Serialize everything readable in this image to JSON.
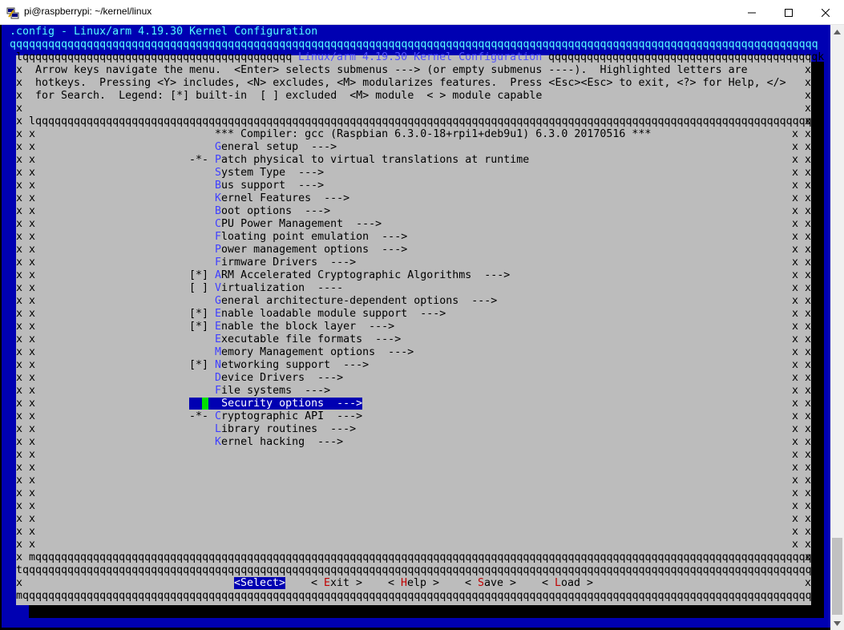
{
  "window": {
    "title": "pi@raspberrypi: ~/kernel/linux",
    "icon": "putty-icon",
    "controls": [
      "minimize",
      "maximize",
      "close"
    ]
  },
  "colors": {
    "terminal_bg": "#0000b2",
    "dialog_bg": "#bcbcbc",
    "hotkey": "#4040ff",
    "selected_bg": "#0000b2",
    "cursor": "#00e000",
    "button_hotkey": "#c00000"
  },
  "terminal": {
    "header": ".config - Linux/arm 4.19.30 Kernel Configuration",
    "fill_line": "qqqqqqqqqqqqqqqqqqqqqqqqqqqqqqqqqqqqqqqqqqqqqqqqqqqqqqqqqqqqqqqqqqqqqqqqqqqqqqqqqqqqqqqqqqqqqqqqqqqqqqqqqqqqqqqqqqqqqqqqqqqqqq"
  },
  "dialog": {
    "title": " Linux/arm 4.19.30 Kernel Configuration ",
    "top_left_fill": "lqqqqqqqqqqqqqqqqqqqqqqqqqqqqqqqqqqqqqqqqqq",
    "top_right_fill": "qqqqqqqqqqqqqqqqqqqqqqqqqqqqqqqqqqqqqqqqqqk",
    "help_lines": [
      "Arrow keys navigate the menu.  <Enter> selects submenus ---> (or empty submenus ----).  Highlighted letters are",
      "hotkeys.  Pressing <Y> includes, <N> excludes, <M> modularizes features.  Press <Esc><Esc> to exit, <?> for Help, </>",
      "for Search.  Legend: [*] built-in  [ ] excluded  <M> module  < > module capable"
    ],
    "menu_top_border": "lqqqqqqqqqqqqqqqqqqqqqqqqqqqqqqqqqqqqqqqqqqqqqqqqqqqqqqqqqqqqqqqqqqqqqqqqqqqqqqqqqqqqqqqqqqqqqqqqqqqqqqqqqqqqqqqqqqqqqqqqqk",
    "menu_bottom_border": "mqqqqqqqqqqqqqqqqqqqqqqqqqqqqqqqqqqqqqqqqqqqqqqqqqqqqqqqqqqqqqqqqqqqqqqqqqqqqqqqqqqqqqqqqqqqqqqqqqqqqqqqqqqqqqqqqqqqqqqqqqj",
    "button_separator": "tqqqqqqqqqqqqqqqqqqqqqqqqqqqqqqqqqqqqqqqqqqqqqqqqqqqqqqqqqqqqqqqqqqqqqqqqqqqqqqqqqqqqqqqqqqqqqqqqqqqqqqqqqqqqqqqqqqqqqqqqqqqu",
    "bottom_border": "mqqqqqqqqqqqqqqqqqqqqqqqqqqqqqqqqqqqqqqqqqqqqqqqqqqqqqqqqqqqqqqqqqqqqqqqqqqqqqqqqqqqqqqqqqqqqqqqqqqqqqqqqqqqqqqqqqqqqqqqqqqqqj",
    "side_char": "x",
    "menu_items": [
      {
        "prefix": "   ",
        "hot": "",
        "rest": "*** Compiler: gcc (Raspbian 6.3.0-18+rpi1+deb9u1) 6.3.0 20170516 ***"
      },
      {
        "prefix": "   ",
        "hot": "G",
        "rest": "eneral setup  --->"
      },
      {
        "prefix": "-*-",
        "hot": "P",
        "rest": "atch physical to virtual translations at runtime"
      },
      {
        "prefix": "   ",
        "hot": "S",
        "rest": "ystem Type  --->"
      },
      {
        "prefix": "   ",
        "hot": "B",
        "rest": "us support  --->"
      },
      {
        "prefix": "   ",
        "hot": "K",
        "rest": "ernel Features  --->"
      },
      {
        "prefix": "   ",
        "hot": "B",
        "rest": "oot options  --->"
      },
      {
        "prefix": "   ",
        "hot": "C",
        "rest": "PU Power Management  --->"
      },
      {
        "prefix": "   ",
        "hot": "F",
        "rest": "loating point emulation  --->"
      },
      {
        "prefix": "   ",
        "hot": "P",
        "rest": "ower management options  --->"
      },
      {
        "prefix": "   ",
        "hot": "F",
        "rest": "irmware Drivers  --->"
      },
      {
        "prefix": "[*]",
        "hot": "A",
        "rest": "RM Accelerated Cryptographic Algorithms  --->"
      },
      {
        "prefix": "[ ]",
        "hot": "V",
        "rest": "irtualization  ----"
      },
      {
        "prefix": "   ",
        "hot": "G",
        "rest": "eneral architecture-dependent options  --->"
      },
      {
        "prefix": "[*]",
        "hot": "E",
        "rest": "nable loadable module support  --->"
      },
      {
        "prefix": "[*]",
        "hot": "E",
        "rest": "nable the block layer  --->"
      },
      {
        "prefix": "   ",
        "hot": "E",
        "rest": "xecutable file formats  --->"
      },
      {
        "prefix": "   ",
        "hot": "M",
        "rest": "emory Management options  --->"
      },
      {
        "prefix": "[*]",
        "hot": "N",
        "rest": "etworking support  --->"
      },
      {
        "prefix": "   ",
        "hot": "D",
        "rest": "evice Drivers  --->"
      },
      {
        "prefix": "   ",
        "hot": "F",
        "rest": "ile systems  --->"
      },
      {
        "prefix": "   ",
        "hot": "S",
        "rest": "ecurity options  --->",
        "selected": true
      },
      {
        "prefix": "-*-",
        "hot": "C",
        "rest": "ryptographic API  --->"
      },
      {
        "prefix": "   ",
        "hot": "L",
        "rest": "ibrary routines  --->"
      },
      {
        "prefix": "   ",
        "hot": "K",
        "rest": "ernel hacking  --->"
      }
    ],
    "buttons": [
      {
        "label": "<Select>",
        "selected": true
      },
      {
        "label": "< Exit >",
        "hot_index": 2
      },
      {
        "label": "< Help >",
        "hot_index": 2
      },
      {
        "label": "< Save >",
        "hot_index": 2
      },
      {
        "label": "< Load >",
        "hot_index": 2
      }
    ]
  }
}
